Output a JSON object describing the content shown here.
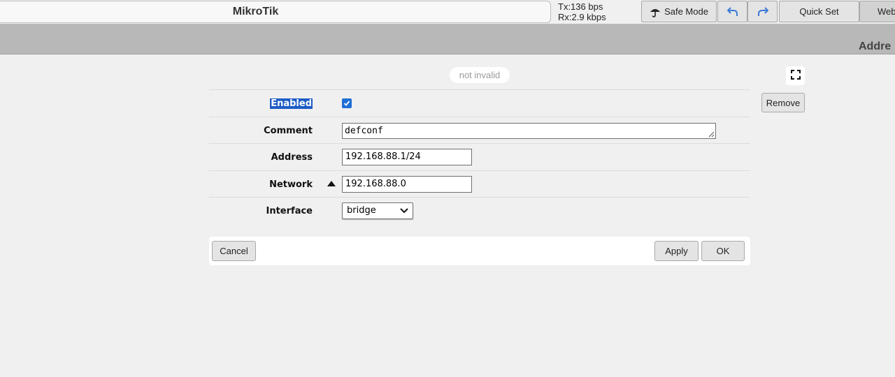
{
  "header": {
    "app_title": "MikroTik",
    "tx": "Tx:136 bps",
    "rx": "Rx:2.9 kbps",
    "safe_mode_label": "Safe Mode",
    "quick_set_label": "Quick Set",
    "webfig_label": "Web",
    "page_title": "Addre"
  },
  "form": {
    "status": "not invalid",
    "remove_label": "Remove",
    "fields": {
      "enabled": {
        "label": "Enabled",
        "checked": true
      },
      "comment": {
        "label": "Comment",
        "value": "defconf"
      },
      "address": {
        "label": "Address",
        "value": "192.168.88.1/24"
      },
      "network": {
        "label": "Network",
        "value": "192.168.88.0"
      },
      "interface": {
        "label": "Interface",
        "value": "bridge"
      }
    }
  },
  "actions": {
    "cancel_label": "Cancel",
    "apply_label": "Apply",
    "ok_label": "OK"
  },
  "colors": {
    "accent": "#1f6fd6",
    "band": "#b8b8b8",
    "selection": "#1d5bc7"
  }
}
